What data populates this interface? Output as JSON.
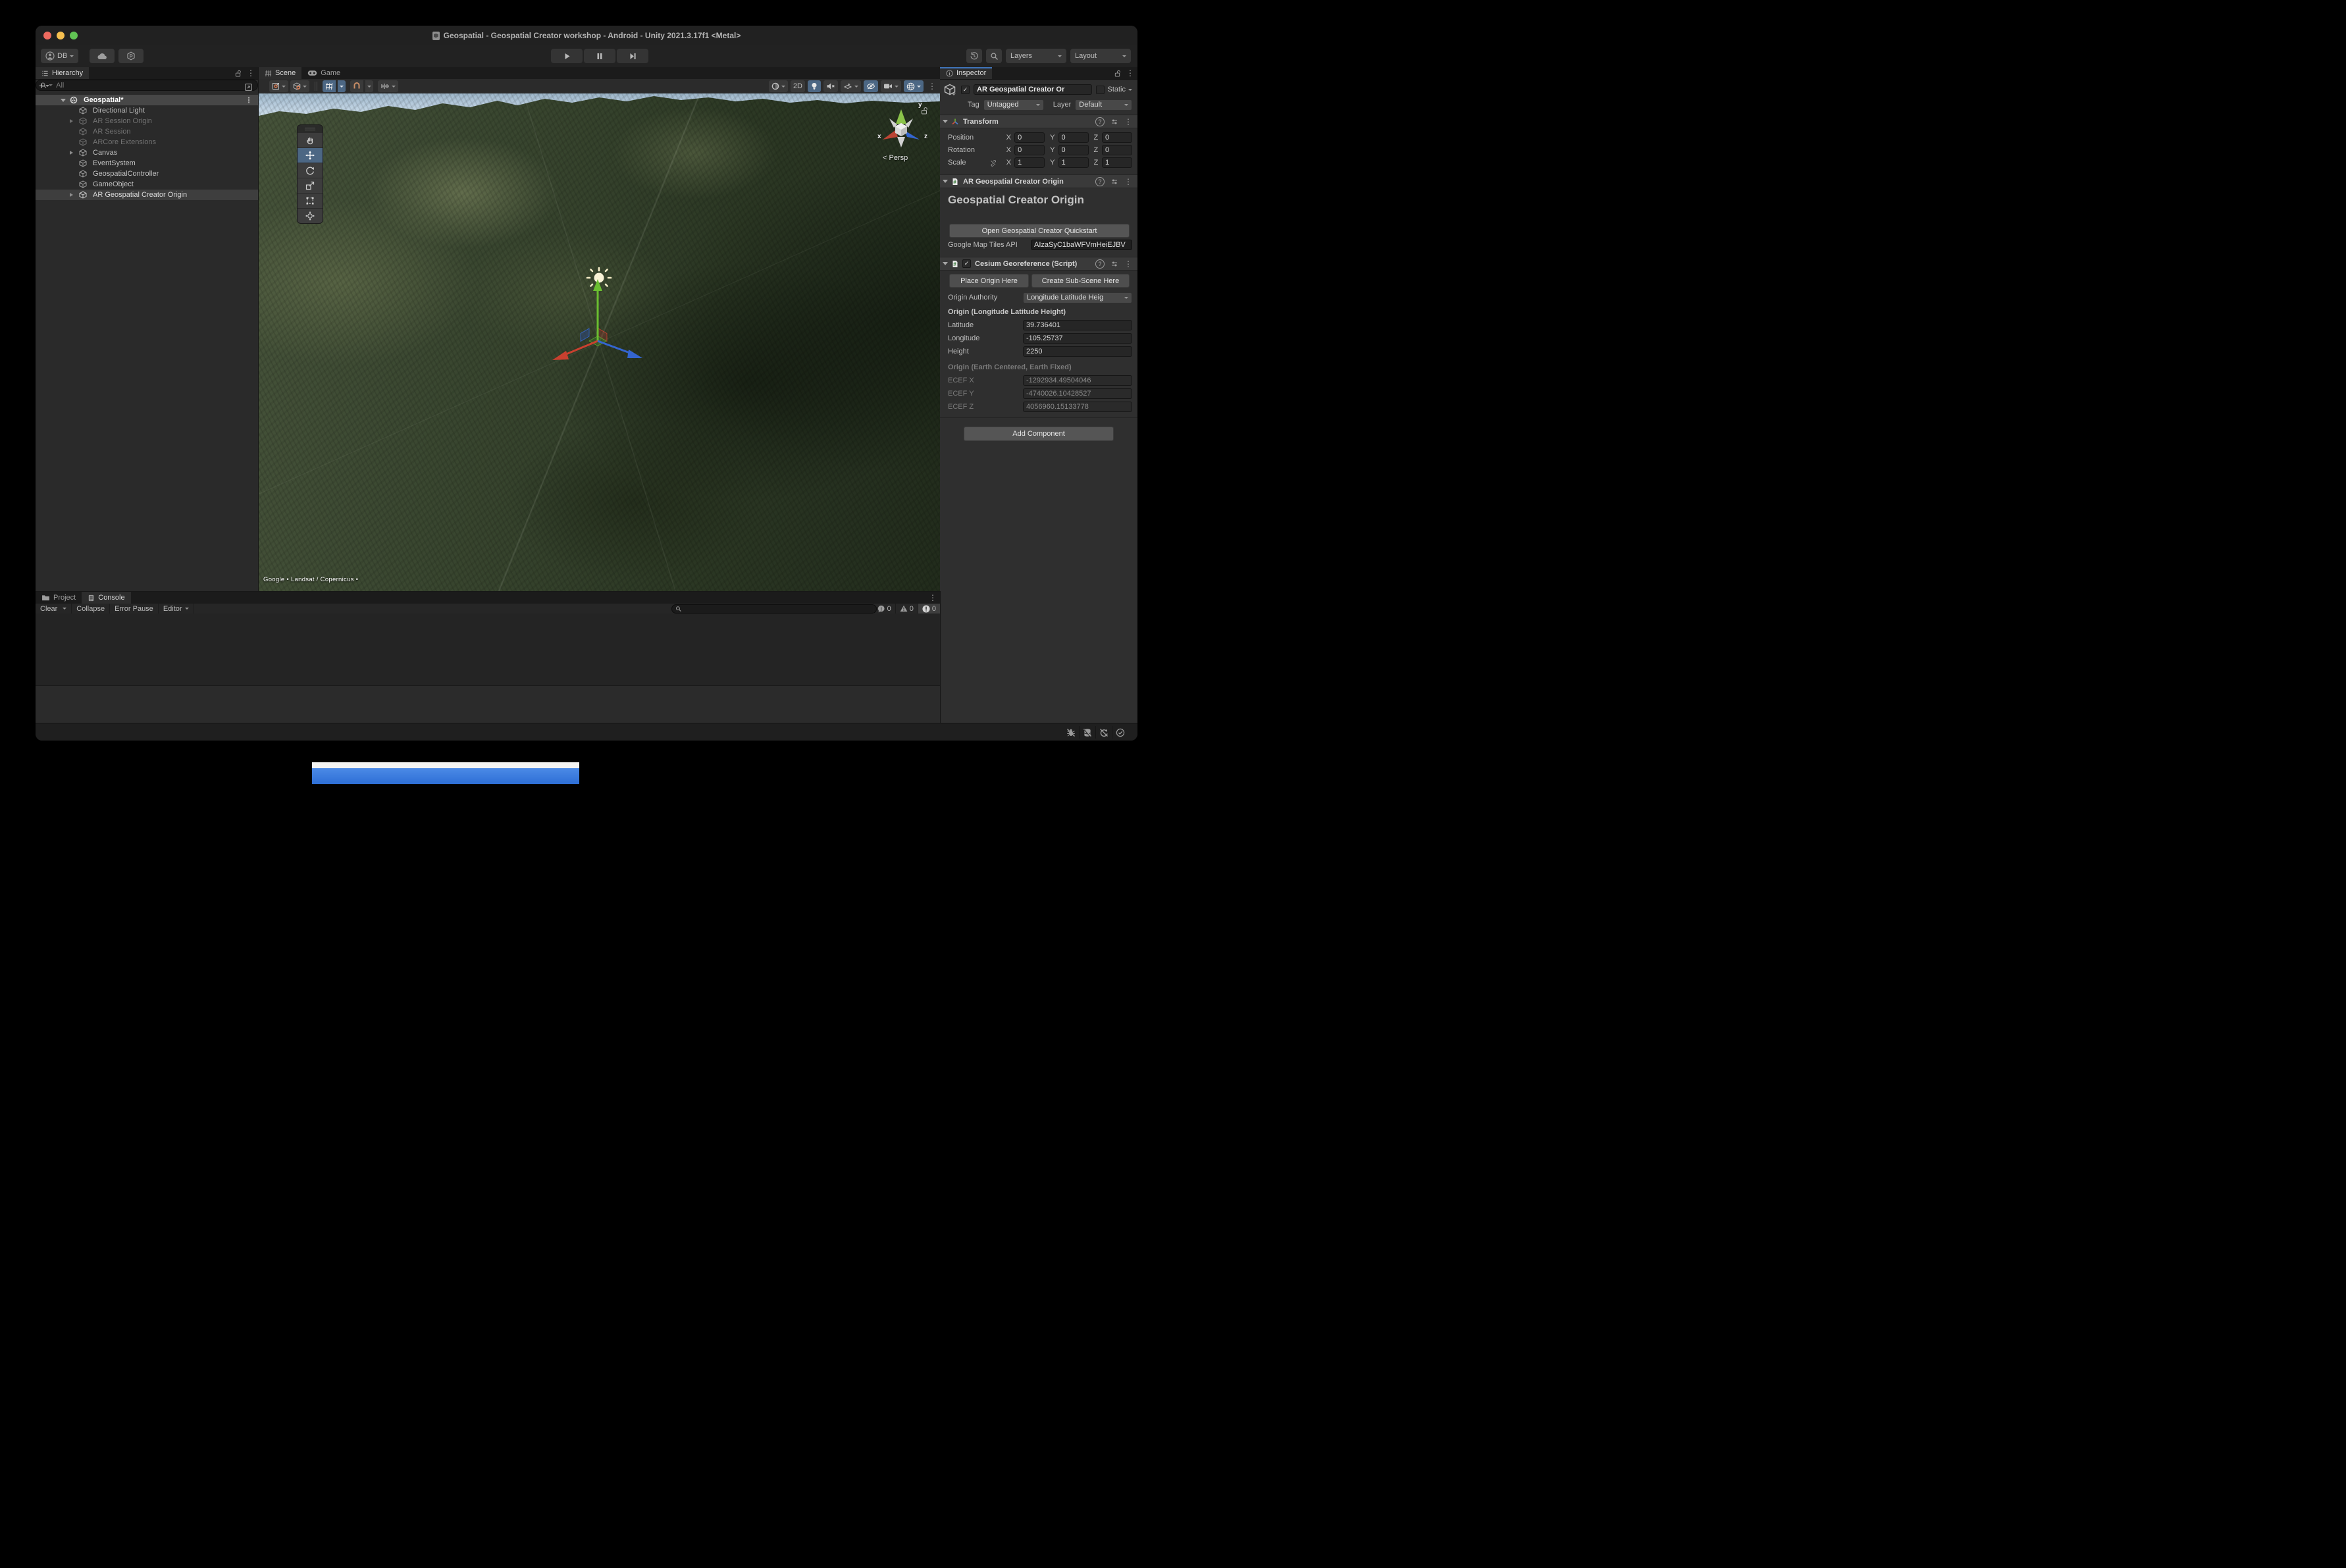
{
  "window": {
    "title": "Geospatial - Geospatial Creator workshop - Android - Unity 2021.3.17f1 <Metal>"
  },
  "toolbar": {
    "account_label": "DB",
    "layers_label": "Layers",
    "layout_label": "Layout"
  },
  "hierarchy": {
    "tab": "Hierarchy",
    "search_placeholder": "All",
    "items": [
      {
        "label": "Geospatial*"
      },
      {
        "label": "Directional Light"
      },
      {
        "label": "AR Session Origin"
      },
      {
        "label": "AR Session"
      },
      {
        "label": "ARCore Extensions"
      },
      {
        "label": "Canvas"
      },
      {
        "label": "EventSystem"
      },
      {
        "label": "GeospatialController"
      },
      {
        "label": "GameObject"
      },
      {
        "label": "AR Geospatial Creator Origin"
      }
    ]
  },
  "scene_view": {
    "tab_scene": "Scene",
    "tab_game": "Game",
    "mode_2d": "2D",
    "persp_label": "< Persp",
    "axis": {
      "x": "x",
      "y": "y",
      "z": "z"
    },
    "attribution": "Google • Landsat / Copernicus •"
  },
  "inspector": {
    "tab": "Inspector",
    "header": {
      "name": "AR Geospatial Creator Or",
      "static_label": "Static",
      "tag_label": "Tag",
      "tag_value": "Untagged",
      "layer_label": "Layer",
      "layer_value": "Default"
    },
    "transform": {
      "title": "Transform",
      "position_label": "Position",
      "rotation_label": "Rotation",
      "scale_label": "Scale",
      "axis_x": "X",
      "axis_y": "Y",
      "axis_z": "Z",
      "position": {
        "x": "0",
        "y": "0",
        "z": "0"
      },
      "rotation": {
        "x": "0",
        "y": "0",
        "z": "0"
      },
      "scale": {
        "x": "1",
        "y": "1",
        "z": "1"
      }
    },
    "geo_origin": {
      "title": "AR Geospatial Creator Origin",
      "heading": "Geospatial Creator Origin",
      "quickstart_button": "Open Geospatial Creator Quickstart",
      "api_label": "Google Map Tiles API",
      "api_value": "AIzaSyC1baWFVmHeiEJBV"
    },
    "cesium": {
      "title": "Cesium Georeference (Script)",
      "place_origin_button": "Place Origin Here",
      "create_subscene_button": "Create Sub-Scene Here",
      "origin_authority_label": "Origin Authority",
      "origin_authority_value": "Longitude Latitude Heig",
      "llh_header": "Origin (Longitude Latitude Height)",
      "latitude_label": "Latitude",
      "latitude": "39.736401",
      "longitude_label": "Longitude",
      "longitude": "-105.25737",
      "height_label": "Height",
      "height": "2250",
      "ecef_header": "Origin (Earth Centered, Earth Fixed)",
      "ecef_x_label": "ECEF X",
      "ecef_x": "-1292934.49504046",
      "ecef_y_label": "ECEF Y",
      "ecef_y": "-4740026.10428527",
      "ecef_z_label": "ECEF Z",
      "ecef_z": "4056960.15133778"
    },
    "add_component_button": "Add Component"
  },
  "console": {
    "tab_project": "Project",
    "tab_console": "Console",
    "clear_label": "Clear",
    "collapse_label": "Collapse",
    "error_pause_label": "Error Pause",
    "editor_label": "Editor",
    "info_count": "0",
    "warn_count": "0",
    "error_count": "0"
  },
  "colors": {
    "accent_blue": "#4c6784",
    "selection_grey": "#474747",
    "terrain_green": "#35422c",
    "sky_blue": "#b9cdde",
    "axis_red": "#c9402f",
    "axis_green": "#6abe30",
    "axis_blue": "#3465cf"
  }
}
